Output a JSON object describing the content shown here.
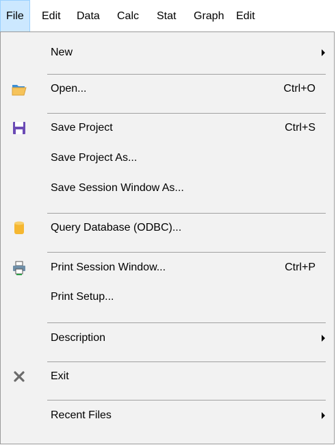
{
  "menubar": {
    "items": [
      {
        "label": "File"
      },
      {
        "label": "Edit"
      },
      {
        "label": "Data"
      },
      {
        "label": "Calc"
      },
      {
        "label": "Stat"
      },
      {
        "label": "Graph"
      },
      {
        "label": "Edit"
      }
    ]
  },
  "file_menu": {
    "new": {
      "label": "New",
      "icon": "none",
      "submenu": true
    },
    "open": {
      "label": "Open...",
      "shortcut": "Ctrl+O",
      "icon": "folder-open-icon"
    },
    "save_project": {
      "label": "Save Project",
      "shortcut": "Ctrl+S",
      "icon": "save-icon"
    },
    "save_project_as": {
      "label": "Save Project As..."
    },
    "save_session_window_as": {
      "label": "Save Session Window As..."
    },
    "query_database": {
      "label": "Query Database (ODBC)...",
      "icon": "database-icon"
    },
    "print_session_window": {
      "label": "Print Session Window...",
      "shortcut": "Ctrl+P",
      "icon": "printer-icon"
    },
    "print_setup": {
      "label": "Print Setup..."
    },
    "description": {
      "label": "Description",
      "submenu": true
    },
    "exit": {
      "label": "Exit",
      "icon": "close-icon"
    },
    "recent_files": {
      "label": "Recent Files",
      "submenu": true
    }
  },
  "colors": {
    "menu_background": "#f2f2f2",
    "active_menubar_background": "#cce8ff",
    "separator": "#a0a0a0"
  }
}
